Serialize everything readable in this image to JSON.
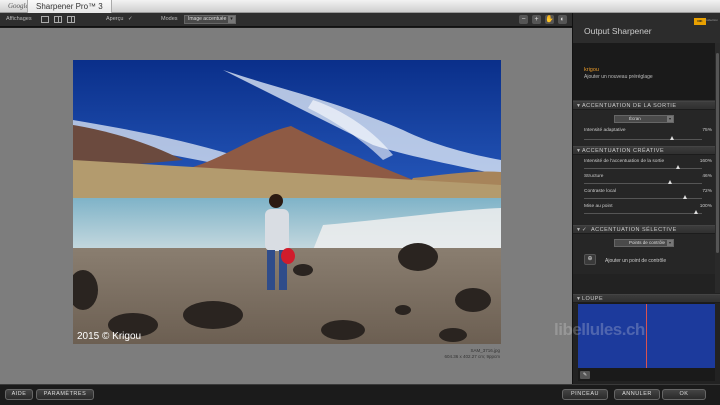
{
  "titlebar": {
    "brand": "Google",
    "app_name": "Sharpener Pro™ 3"
  },
  "toolbar": {
    "views_label": "Affichages",
    "preview_label": "Aperçu",
    "mode_label": "Modes",
    "mode_value": "Image accentuée",
    "icons": [
      "zoom-out-icon",
      "zoom-in-icon",
      "hand-icon",
      "compare-icon"
    ]
  },
  "image": {
    "watermark": "2015 © Krigou",
    "filename": "SAM_3716.jpg",
    "dimensions": "604.36 x 402.27 cm; 9ppcm"
  },
  "panel": {
    "title": "Output Sharpener",
    "badge": "NIK",
    "badge_sub": "Collection",
    "preset_name": "krigou",
    "preset_add": "Ajouter un nouveau préréglage",
    "sec1": {
      "title": "ACCENTUATION DE LA SORTIE",
      "dropdown": "Écran",
      "params": [
        {
          "label": "Intensité adaptative",
          "value": "75%",
          "fraction": 0.75
        }
      ]
    },
    "sec2": {
      "title": "ACCENTUATION CRÉATIVE",
      "params": [
        {
          "label": "Intensité de l'accentuation de la sortie",
          "value": "160%",
          "fraction": 0.8
        },
        {
          "label": "Structure",
          "value": "46%",
          "fraction": 0.73
        },
        {
          "label": "Contraste local",
          "value": "72%",
          "fraction": 0.86
        },
        {
          "label": "Mise au point",
          "value": "100%",
          "fraction": 0.95
        }
      ]
    },
    "sec3": {
      "title": "ACCENTUATION SÉLECTIVE",
      "dropdown": "Points de contrôle",
      "add_point": "Ajouter un point de contrôle"
    },
    "loupe": {
      "title": "LOUPE"
    }
  },
  "site_watermark": "libellules.ch",
  "bottom": {
    "help": "AIDE",
    "settings": "PARAMÈTRES",
    "brush": "PINCEAU",
    "cancel": "ANNULER",
    "ok": "OK"
  }
}
